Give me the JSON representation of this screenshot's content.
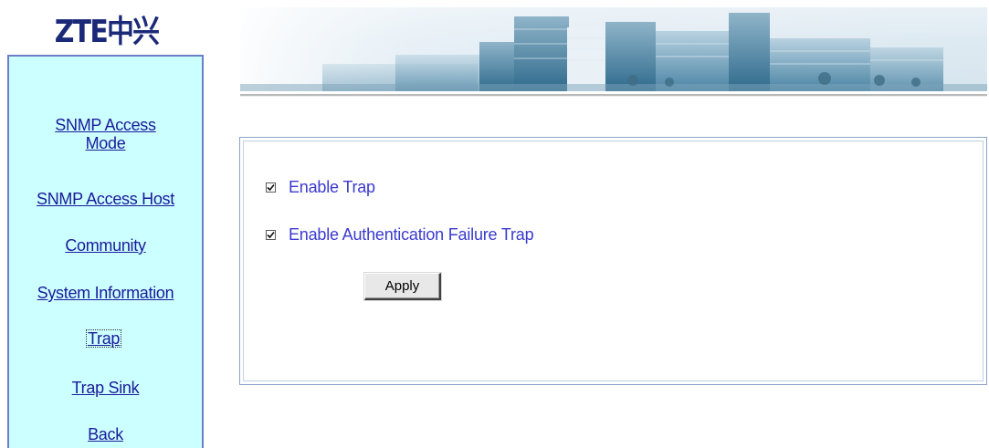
{
  "logo": {
    "text": "ZTE中兴"
  },
  "sidebar": {
    "items": [
      {
        "label": "SNMP Access Mode"
      },
      {
        "label": "SNMP Access Host"
      },
      {
        "label": "Community"
      },
      {
        "label": "System Information"
      },
      {
        "label": "Trap",
        "selected": true
      },
      {
        "label": "Trap Sink"
      },
      {
        "label": "Back"
      }
    ]
  },
  "trap_settings": {
    "enable_trap": {
      "label": "Enable Trap",
      "checked": true
    },
    "enable_auth_failure_trap": {
      "label": "Enable Authentication Failure Trap",
      "checked": true
    },
    "apply_label": "Apply"
  },
  "colors": {
    "sidebar_bg": "#ccffff",
    "sidebar_border": "#6a7fc8",
    "link": "#1a1a9a",
    "option_label": "#3a3ad0",
    "logo": "#1a2a78"
  }
}
